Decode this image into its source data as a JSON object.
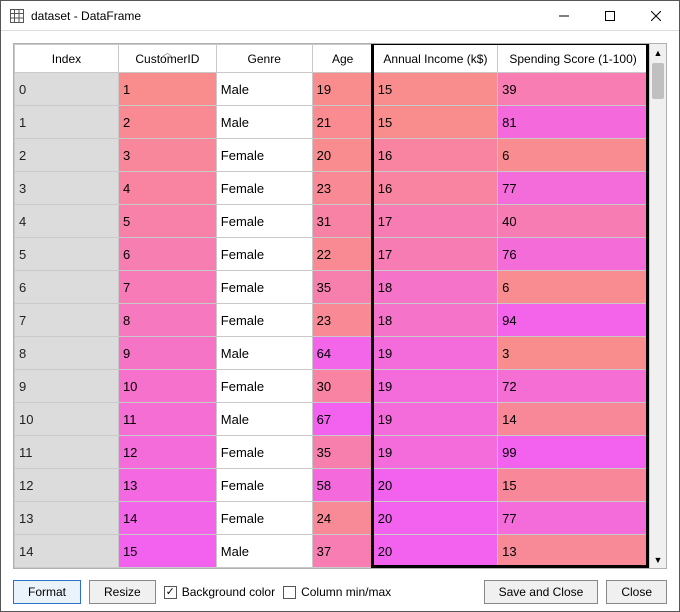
{
  "window": {
    "title": "dataset - DataFrame",
    "icon": "table-icon"
  },
  "columns": [
    "Index",
    "CustomerID",
    "Genre",
    "Age",
    "Annual Income (k$)",
    "Spending Score (1-100)"
  ],
  "rows": [
    {
      "index": 0,
      "id": 1,
      "genre": "Male",
      "age": 19,
      "income": 15,
      "score": 39
    },
    {
      "index": 1,
      "id": 2,
      "genre": "Male",
      "age": 21,
      "income": 15,
      "score": 81
    },
    {
      "index": 2,
      "id": 3,
      "genre": "Female",
      "age": 20,
      "income": 16,
      "score": 6
    },
    {
      "index": 3,
      "id": 4,
      "genre": "Female",
      "age": 23,
      "income": 16,
      "score": 77
    },
    {
      "index": 4,
      "id": 5,
      "genre": "Female",
      "age": 31,
      "income": 17,
      "score": 40
    },
    {
      "index": 5,
      "id": 6,
      "genre": "Female",
      "age": 22,
      "income": 17,
      "score": 76
    },
    {
      "index": 6,
      "id": 7,
      "genre": "Female",
      "age": 35,
      "income": 18,
      "score": 6
    },
    {
      "index": 7,
      "id": 8,
      "genre": "Female",
      "age": 23,
      "income": 18,
      "score": 94
    },
    {
      "index": 8,
      "id": 9,
      "genre": "Male",
      "age": 64,
      "income": 19,
      "score": 3
    },
    {
      "index": 9,
      "id": 10,
      "genre": "Female",
      "age": 30,
      "income": 19,
      "score": 72
    },
    {
      "index": 10,
      "id": 11,
      "genre": "Male",
      "age": 67,
      "income": 19,
      "score": 14
    },
    {
      "index": 11,
      "id": 12,
      "genre": "Female",
      "age": 35,
      "income": 19,
      "score": 99
    },
    {
      "index": 12,
      "id": 13,
      "genre": "Female",
      "age": 58,
      "income": 20,
      "score": 15
    },
    {
      "index": 13,
      "id": 14,
      "genre": "Female",
      "age": 24,
      "income": 20,
      "score": 77
    },
    {
      "index": 14,
      "id": 15,
      "genre": "Male",
      "age": 37,
      "income": 20,
      "score": 13
    }
  ],
  "selection": {
    "left_col": 4,
    "right_col": 5
  },
  "footer": {
    "format_btn": "Format",
    "resize_btn": "Resize",
    "bgcolor_check": {
      "label": "Background color",
      "checked": true
    },
    "minmax_check": {
      "label": "Column min/max",
      "checked": false
    },
    "save_btn": "Save and Close",
    "close_btn": "Close"
  },
  "colors": {
    "salmon_light": "#f98d8d",
    "salmon_mid": "#f77d7d",
    "pink": "#f97fd0",
    "magenta": "#f263ef",
    "genre_bg": "#ffffff"
  }
}
